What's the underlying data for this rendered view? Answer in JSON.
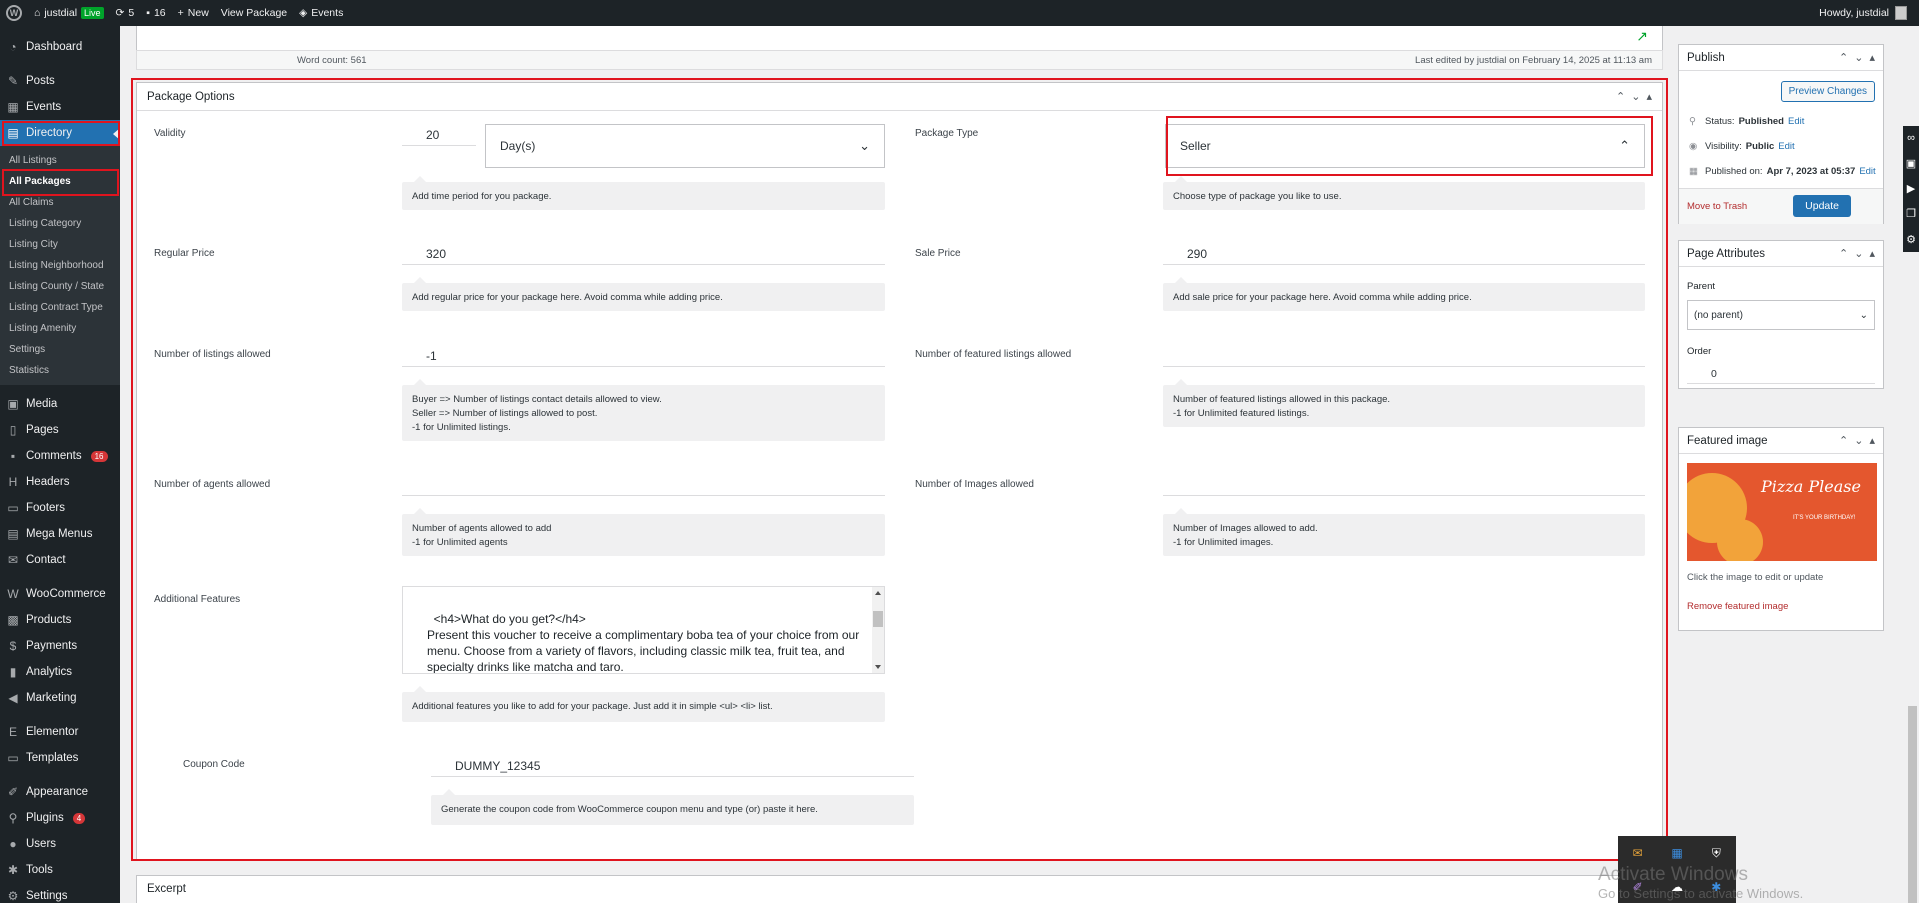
{
  "admin_bar": {
    "site_name": "justdial",
    "live": "Live",
    "updates_count": "5",
    "comments_count": "16",
    "new_label": "New",
    "view_package": "View Package",
    "events": "Events",
    "howdy": "Howdy, justdial"
  },
  "sidebar": {
    "dashboard": "Dashboard",
    "posts": "Posts",
    "events": "Events",
    "directory": "Directory",
    "submenu": [
      "All Listings",
      "All Packages",
      "All Claims",
      "Listing Category",
      "Listing City",
      "Listing Neighborhood",
      "Listing County / State",
      "Listing Contract Type",
      "Listing Amenity",
      "Settings",
      "Statistics"
    ],
    "media": "Media",
    "pages": "Pages",
    "comments": "Comments",
    "comments_badge": "16",
    "headers": "Headers",
    "footers": "Footers",
    "mega_menus": "Mega Menus",
    "contact": "Contact",
    "woocommerce": "WooCommerce",
    "products": "Products",
    "payments": "Payments",
    "analytics": "Analytics",
    "marketing": "Marketing",
    "elementor": "Elementor",
    "templates": "Templates",
    "appearance": "Appearance",
    "plugins": "Plugins",
    "plugins_badge": "4",
    "users": "Users",
    "tools": "Tools",
    "settings": "Settings"
  },
  "editor_footer": {
    "word_count": "Word count: 561",
    "last_edited": "Last edited by justdial on February 14, 2025 at 11:13 am"
  },
  "package_options": {
    "title": "Package Options",
    "validity_label": "Validity",
    "validity_value": "20",
    "validity_unit": "Day(s)",
    "validity_help": "Add time period for you package.",
    "package_type_label": "Package Type",
    "package_type_value": "Seller",
    "package_type_help": "Choose type of package you like to use.",
    "regular_price_label": "Regular Price",
    "regular_price_value": "320",
    "regular_price_help": "Add regular price for your package here. Avoid comma while adding price.",
    "sale_price_label": "Sale Price",
    "sale_price_value": "290",
    "sale_price_help": "Add sale price for your package here. Avoid comma while adding price.",
    "listings_label": "Number of listings allowed",
    "listings_value": "-1",
    "listings_help_1": "Buyer => Number of listings contact details allowed to view.",
    "listings_help_2": "Seller => Number of listings allowed to post.",
    "listings_help_3": "-1 for Unlimited listings.",
    "featured_label": "Number of featured listings allowed",
    "featured_help_1": "Number of featured listings allowed in this package.",
    "featured_help_2": "-1 for Unlimited featured listings.",
    "agents_label": "Number of agents allowed",
    "agents_help_1": "Number of agents allowed to add",
    "agents_help_2": "-1 for Unlimited agents",
    "images_label": "Number of Images allowed",
    "images_help_1": "Number of Images allowed to add.",
    "images_help_2": "-1 for Unlimited images.",
    "features_label": "Additional Features",
    "features_text": "<h4>What do you get?</h4>\nPresent this voucher to receive a complimentary boba tea of your choice from our menu. Choose from a variety of flavors, including classic milk tea, fruit tea, and specialty drinks like matcha and taro.\nOur boba teas are made with premium ingredients and hand-crafted to perfection.",
    "features_help": "Additional features you like to add for your package. Just add it in simple <ul> <li> list.",
    "coupon_label": "Coupon Code",
    "coupon_value": "DUMMY_12345",
    "coupon_help": "Generate the coupon code from WooCommerce coupon menu and type (or) paste it here."
  },
  "excerpt": {
    "title": "Excerpt"
  },
  "publish": {
    "title": "Publish",
    "preview": "Preview Changes",
    "status_label": "Status:",
    "status_value": "Published",
    "visibility_label": "Visibility:",
    "visibility_value": "Public",
    "published_on_label": "Published on:",
    "published_on_value": "Apr 7, 2023 at 05:37",
    "edit": "Edit",
    "trash": "Move to Trash",
    "update": "Update"
  },
  "page_attributes": {
    "title": "Page Attributes",
    "parent_label": "Parent",
    "parent_value": "(no parent)",
    "order_label": "Order",
    "order_value": "0"
  },
  "featured_image": {
    "title": "Featured image",
    "image_heading": "Pizza Please",
    "image_sub": "IT'S YOUR BIRTHDAY!",
    "hint": "Click the image to edit or update",
    "remove": "Remove featured image"
  },
  "windows": {
    "activate_title": "Activate Windows",
    "activate_sub": "Go to Settings to activate Windows."
  },
  "colors": {
    "admin_dark": "#1d2327",
    "wp_blue": "#2271b1",
    "highlight_red": "#e0141e",
    "image_orange": "#e4572e"
  }
}
